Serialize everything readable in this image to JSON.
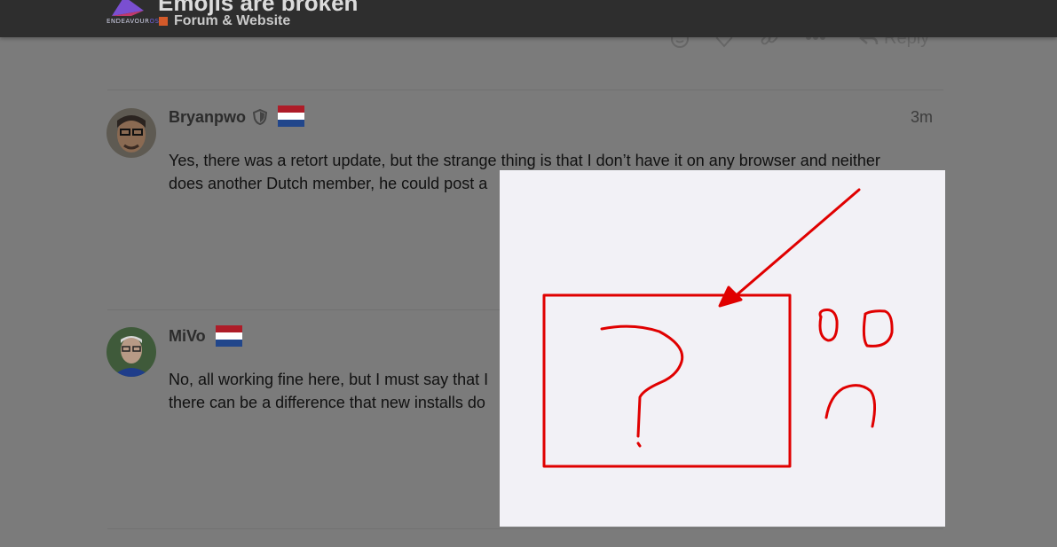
{
  "header": {
    "brand_word": "ENDEAVOUR",
    "brand_tail": "OS",
    "topic_title": "Emojis are broken",
    "category": "Forum & Website"
  },
  "actions": {
    "reply_label": "Reply"
  },
  "posts": [
    {
      "username": "Bryanpwo",
      "time": "3m",
      "lines": [
        "Yes, there was a retort update, but the strange thing is that I don’t have it on any browser and neither",
        "does another Dutch member, he could post a"
      ]
    },
    {
      "username": "MiVo",
      "lines": [
        "No, all working fine here, but I must say that I",
        "there can be a difference that new installs do"
      ]
    }
  ],
  "colors": {
    "header_bg": "#2e2e2e",
    "category_square": "#d35a2a",
    "drawing_red": "#e00000",
    "panel_bg": "#f2f1f6",
    "flag_red": "#ae1c28",
    "flag_white": "#ffffff",
    "flag_blue": "#21468b"
  }
}
